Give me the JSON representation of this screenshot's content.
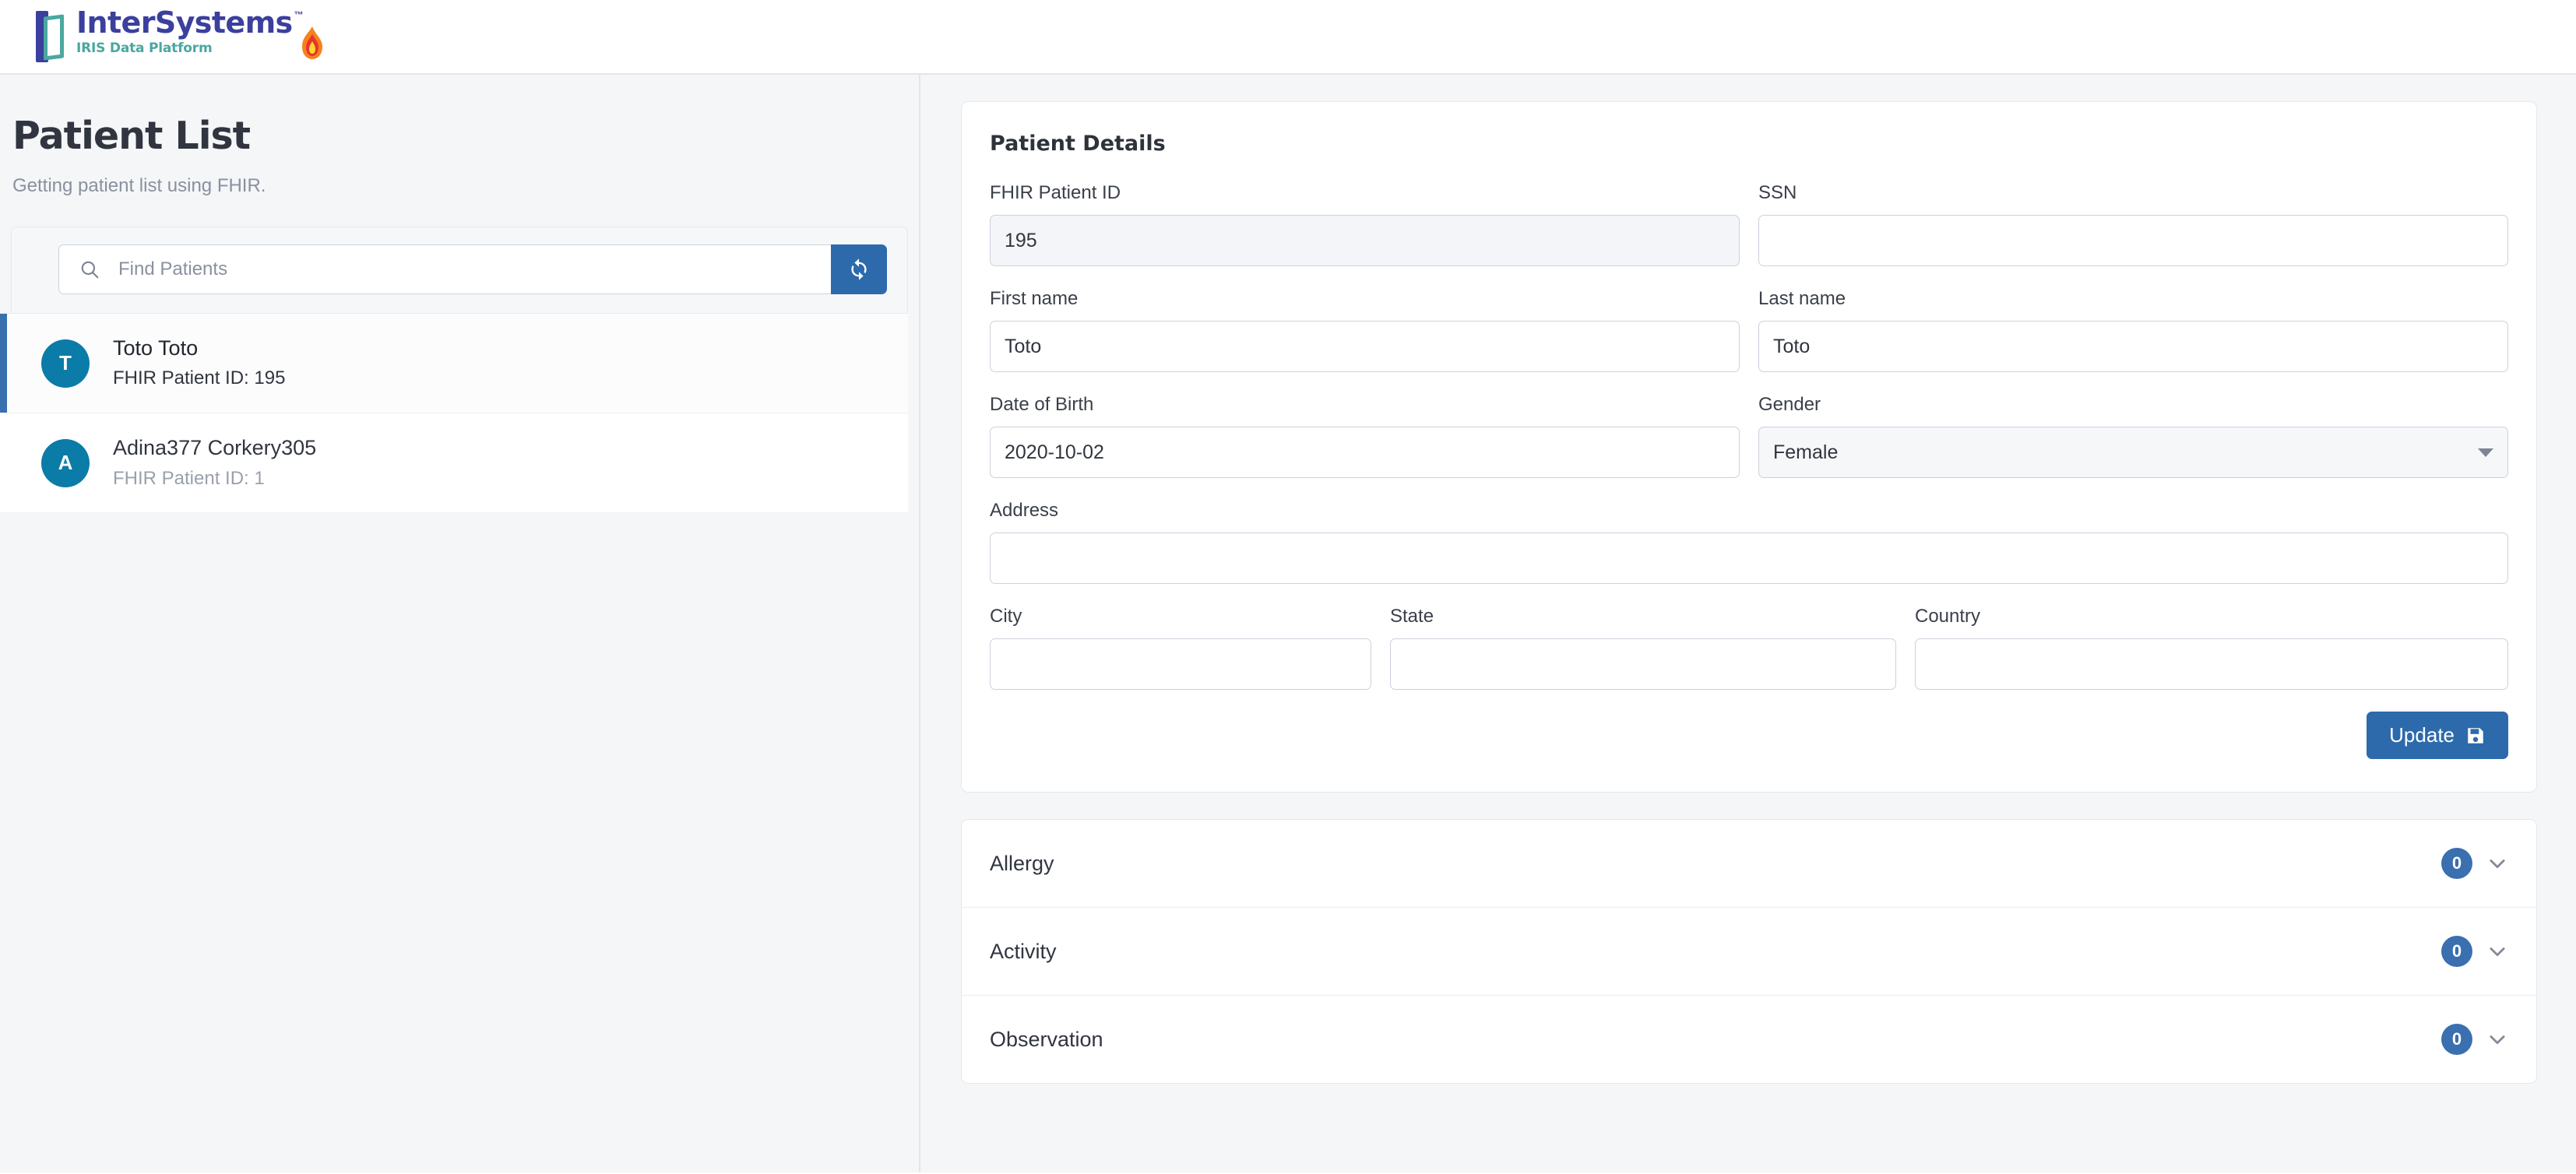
{
  "header": {
    "logo_brand": "InterSystems",
    "logo_tm": "™",
    "logo_sub": "IRIS Data Platform",
    "logo_icon": "intersystems-door-logo",
    "flame_icon": "flame-icon"
  },
  "sidebar": {
    "title": "Patient List",
    "subtitle": "Getting patient list using FHIR.",
    "search": {
      "placeholder": "Find Patients",
      "value": "",
      "icon": "search-icon",
      "refresh_icon": "refresh-icon"
    },
    "patients": [
      {
        "initial": "T",
        "name": "Toto Toto",
        "id_label": "FHIR Patient ID: 195",
        "selected": true
      },
      {
        "initial": "A",
        "name": "Adina377 Corkery305",
        "id_label": "FHIR Patient ID: 1",
        "selected": false
      }
    ]
  },
  "details": {
    "title": "Patient Details",
    "fields": {
      "fhir_id_label": "FHIR Patient ID",
      "fhir_id_value": "195",
      "ssn_label": "SSN",
      "ssn_value": "",
      "first_name_label": "First name",
      "first_name_value": "Toto",
      "last_name_label": "Last name",
      "last_name_value": "Toto",
      "dob_label": "Date of Birth",
      "dob_value": "2020-10-02",
      "gender_label": "Gender",
      "gender_value": "Female",
      "address_label": "Address",
      "address_value": "",
      "city_label": "City",
      "city_value": "",
      "state_label": "State",
      "state_value": "",
      "country_label": "Country",
      "country_value": ""
    },
    "update_label": "Update",
    "update_icon": "save-icon"
  },
  "accordions": [
    {
      "label": "Allergy",
      "count": "0",
      "chevron": "chevron-down-icon"
    },
    {
      "label": "Activity",
      "count": "0",
      "chevron": "chevron-down-icon"
    },
    {
      "label": "Observation",
      "count": "0",
      "chevron": "chevron-down-icon"
    }
  ],
  "colors": {
    "primary_blue": "#2c6aac",
    "accent_blue": "#3a6fb0",
    "avatar_teal": "#0b7ba7",
    "brand_navy": "#3b3f9e",
    "brand_teal": "#4aa8a0",
    "page_bg": "#f4f6f8"
  }
}
